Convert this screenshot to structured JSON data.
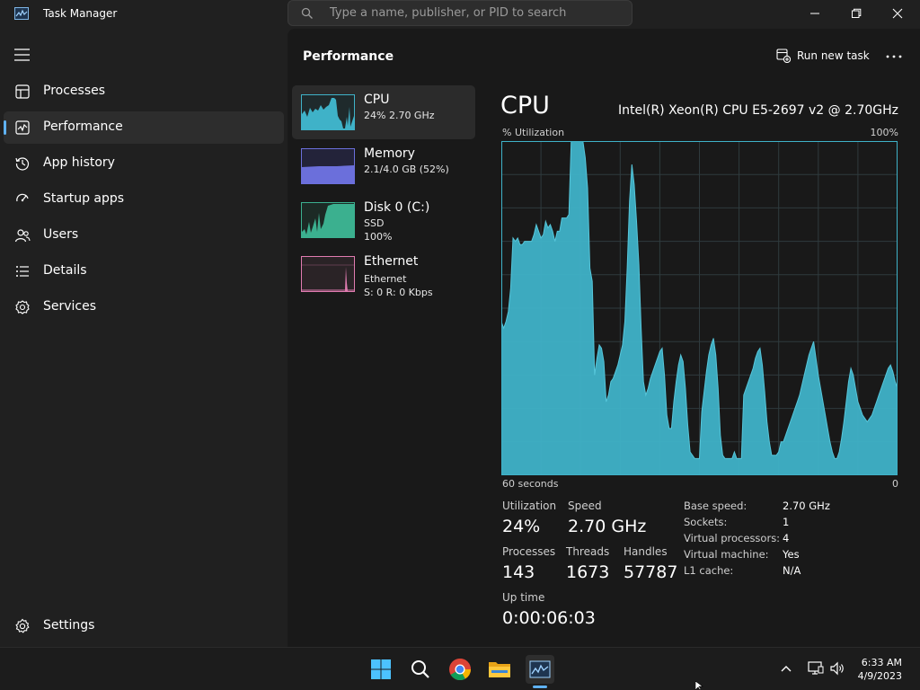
{
  "window": {
    "title": "Task Manager",
    "search_placeholder": "Type a name, publisher, or PID to search"
  },
  "sidebar": {
    "items": [
      {
        "label": "Processes",
        "icon": "processes-icon"
      },
      {
        "label": "Performance",
        "icon": "performance-icon",
        "active": true
      },
      {
        "label": "App history",
        "icon": "history-icon"
      },
      {
        "label": "Startup apps",
        "icon": "startup-icon"
      },
      {
        "label": "Users",
        "icon": "users-icon"
      },
      {
        "label": "Details",
        "icon": "details-icon"
      },
      {
        "label": "Services",
        "icon": "services-icon"
      }
    ],
    "settings_label": "Settings"
  },
  "header": {
    "title": "Performance",
    "run_task_label": "Run new task"
  },
  "devices": [
    {
      "name": "CPU",
      "line1": "24%  2.70 GHz",
      "line2": "",
      "color": "#3fb2c8"
    },
    {
      "name": "Memory",
      "line1": "2.1/4.0 GB (52%)",
      "line2": "",
      "color": "#6b6fdb"
    },
    {
      "name": "Disk 0 (C:)",
      "line1": "SSD",
      "line2": "100%",
      "color": "#3bb08f"
    },
    {
      "name": "Ethernet",
      "line1": "Ethernet",
      "line2": "S: 0  R: 0 Kbps",
      "color": "#e07bb0"
    }
  ],
  "detail": {
    "title": "CPU",
    "model": "Intel(R) Xeon(R) CPU E5-2697 v2 @ 2.70GHz",
    "y_label": "% Utilization",
    "y_max_label": "100%",
    "x_left_label": "60 seconds",
    "x_right_label": "0",
    "stats": {
      "utilization_label": "Utilization",
      "utilization": "24%",
      "speed_label": "Speed",
      "speed": "2.70 GHz",
      "processes_label": "Processes",
      "processes": "143",
      "threads_label": "Threads",
      "threads": "1673",
      "handles_label": "Handles",
      "handles": "57787",
      "uptime_label": "Up time",
      "uptime": "0:00:06:03"
    },
    "info": [
      {
        "key": "Base speed:",
        "value": "2.70 GHz"
      },
      {
        "key": "Sockets:",
        "value": "1"
      },
      {
        "key": "Virtual processors:",
        "value": "4"
      },
      {
        "key": "Virtual machine:",
        "value": "Yes"
      },
      {
        "key": "L1 cache:",
        "value": "N/A"
      }
    ]
  },
  "chart_data": {
    "type": "area",
    "ylabel": "% Utilization",
    "ylim": [
      0,
      100
    ],
    "x_range_seconds": [
      60,
      0
    ],
    "values": [
      46,
      44,
      46,
      49,
      56,
      71,
      70,
      71,
      69,
      69,
      70,
      70,
      70,
      70,
      72,
      75,
      73,
      71,
      72,
      76,
      74,
      75,
      73,
      70,
      73,
      73,
      77,
      77,
      77,
      78,
      100,
      100,
      100,
      100,
      100,
      100,
      95,
      86,
      62,
      58,
      30,
      35,
      39,
      38,
      34,
      22,
      24,
      28,
      29,
      31,
      33,
      36,
      39,
      46,
      62,
      82,
      93,
      87,
      76,
      63,
      44,
      28,
      24,
      26,
      29,
      31,
      33,
      35,
      37,
      38,
      30,
      18,
      14,
      14,
      22,
      28,
      33,
      36,
      34,
      26,
      15,
      7,
      6,
      5,
      5,
      5,
      19,
      25,
      31,
      36,
      39,
      41,
      36,
      26,
      12,
      6,
      5,
      5,
      5,
      5,
      7,
      5,
      5,
      5,
      24,
      26,
      28,
      30,
      32,
      35,
      37,
      38,
      33,
      25,
      16,
      10,
      6,
      6,
      6,
      7,
      10,
      10,
      12,
      14,
      16,
      18,
      20,
      22,
      24,
      27,
      30,
      33,
      36,
      38,
      40,
      35,
      30,
      26,
      22,
      18,
      14,
      10,
      7,
      5,
      5,
      7,
      11,
      16,
      22,
      28,
      32,
      30,
      26,
      22,
      20,
      18,
      17,
      16,
      17,
      18,
      20,
      22,
      24,
      26,
      28,
      30,
      32,
      33,
      31,
      28,
      26
    ],
    "color": "#3fb2c8"
  },
  "taskbar": {
    "time": "6:33 AM",
    "date": "4/9/2023"
  },
  "colors": {
    "accent": "#5fb2f2",
    "cpu": "#3fb2c8"
  }
}
